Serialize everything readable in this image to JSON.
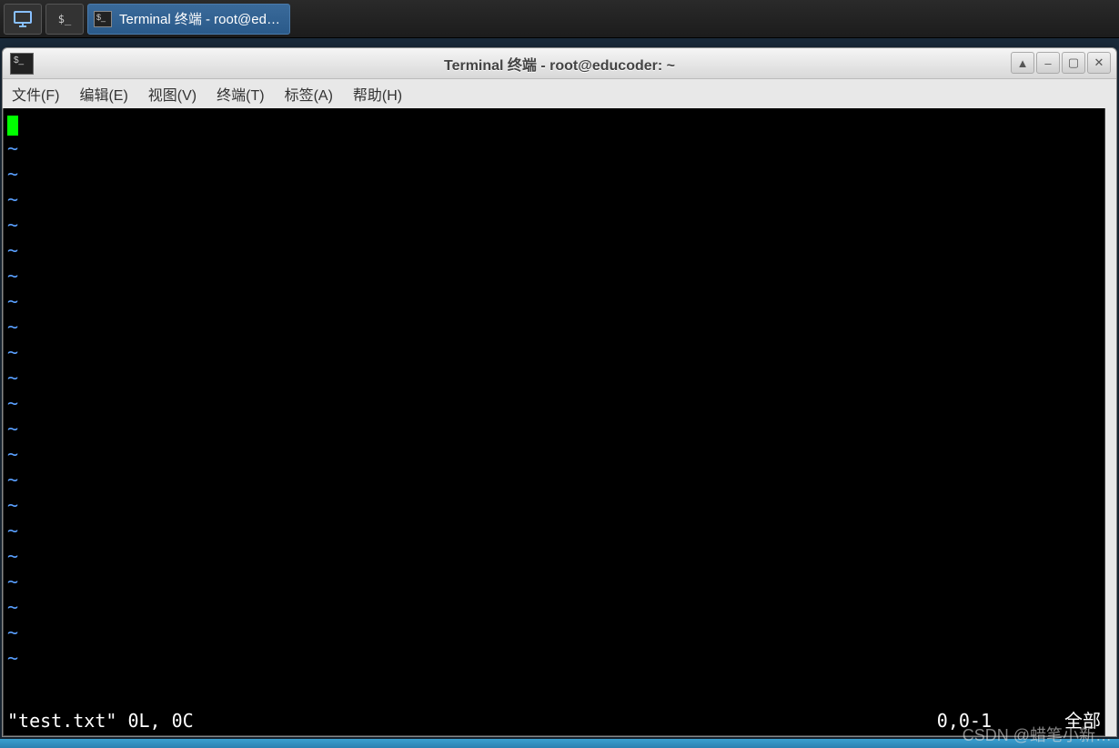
{
  "taskbar": {
    "app_label": "Terminal 终端 - root@ed…"
  },
  "window": {
    "title": "Terminal 终端 - root@educoder: ~",
    "controls": {
      "up": "▲",
      "min": "–",
      "max": "▢",
      "close": "✕"
    }
  },
  "menu": {
    "file": "文件(F)",
    "edit": "编辑(E)",
    "view": "视图(V)",
    "terminal": "终端(T)",
    "tabs": "标签(A)",
    "help": "帮助(H)"
  },
  "editor": {
    "tilde": "~",
    "status_left": "\"test.txt\" 0L, 0C",
    "status_pos": "0,0-1",
    "status_right": "全部"
  },
  "watermark": "CSDN @蜡笔小新…"
}
